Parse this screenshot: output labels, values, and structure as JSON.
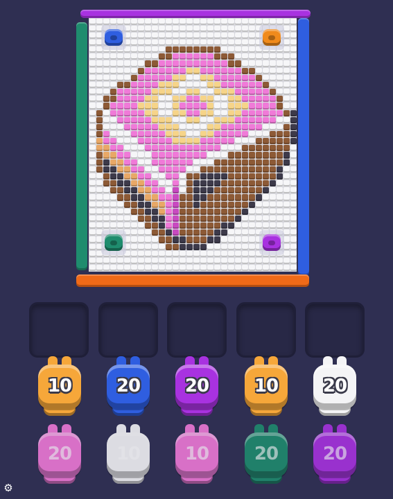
{
  "colors": {
    "background": "#2f2f52",
    "W": "#f6f6f8",
    "P": "#f07ad8",
    "M": "#c84ac0",
    "Y": "#f6d489",
    "T": "#e8a867",
    "B": "#8d5a36",
    "D": "#3d3a4a",
    "G": "#1f9a78",
    "rail_purple": "#a832e0",
    "rail_blue": "#2f5ee0",
    "rail_green": "#1f8c6e",
    "rail_orange": "#f06a18"
  },
  "pixel_art": [
    "WWWWWWWWWWWWWWWWWWWWWWWWWWWWWW",
    "WWWWWWWWWWWWWWWWWWWWWWWWWWWWWW",
    "WWWWWWWWWWWWWWWWWWWWWWWWWWWWWW",
    "WWWWWWWWWWWWWWWWWWWWWWWWWWWWWW",
    "WWWWWWWWWWWBBBBBBBBWWWWWWWWWWW",
    "WWWWWWWWWWBBPPPPPPBBBWWWWWWWWW",
    "WWWWWWWWBBPPPPPPPPPPBBWWWWWWWW",
    "WWWWWWWBPPPPPPYYPPPPPPBBWWWWWW",
    "WWWWWWBPPPPPYYWWYYPPPPPPBWWWWW",
    "WWWWBBPPPPYYYWWWWYYPPPPPPBWWWW",
    "WWWBPPPPPYYYWWYYWWYYYPPPPPBWWW",
    "WWBBPPPPYYWWYYPPYYWWYYPPPPPBWW",
    "WWBPPPPYYYWWYPPPPYWWYYYPPPPBWW",
    "WBWPPPPPYYWWYYPPYYWWYYPPPPPPBD",
    "WBWWPPPPPYYYWWYYWWYYYPPPPPPWWD",
    "WBWWWPPPPPYYYWWWWYYPPPPPPWWWBD",
    "WBPWWWPPPPPYYYWWYYPPPPPWWWBBBD",
    "WTPPWWWPPPPPYYYYPPPPPWWWBBBBBD",
    "WTTPPWWWPPPPPPPPPPPWWWBBBBBBBW",
    "WBTTPPWWWPPPPPPPPWWWBBBBBBBBDW",
    "WBDTTPPWWPPPPPPWWWBBBBBBBBBBDW",
    "WBDDTTPPWWPPPPWWBBBBBBBBBBBDWW",
    "WWBDDTTPPWWPPWBBDDDDBBBBBBBDWW",
    "WWBBDDTTPPWWPWBDDDDBBBBBBBDWWW",
    "WWWBBDDTTPPWMWBDDDBBBBBBBDWWWW",
    "WWWWBBDDTTPPMBBDDBBBBBBBDWWWWW",
    "WWWWWBBDDTTPMBBDBBBBBBBDWWWWWW",
    "WWWWWWBBDDTPMBBBBBBBBBDWWWWWWW",
    "WWWWWWWBBDDPMBBBBBBBBDWWWWWWWW",
    "WWWWWWWWBBDPMBBBBBBDDWWWWWWWWW",
    "WWWWWWWWWBBDMBBBBBDDWWWWWWWWWW",
    "WWWWWWWWWWBBDDBBBDDWWWWWWWWWWW",
    "WWWWWWWWWWWBBDDDDWWWWWWWWWWWWW",
    "WWWWWWWWWWWWWWWWWWWWWWWWWWWWWW",
    "WWWWWWWWWWWWWWWWWWWWWWWWWWWWWW",
    "WWWWWWWWWWWWWWWWWWWWWWWWWWWWWW"
  ],
  "corner_launchers": [
    {
      "name": "launcher-top-left",
      "color": "#2f5ee0"
    },
    {
      "name": "launcher-top-right",
      "color": "#f08a1c"
    },
    {
      "name": "launcher-bottom-left",
      "color": "#1f8c6e"
    },
    {
      "name": "launcher-bottom-right",
      "color": "#a832e0"
    }
  ],
  "empty_slots": [
    "slot-1",
    "slot-2",
    "slot-3",
    "slot-4",
    "slot-5"
  ],
  "queue": [
    [
      {
        "count": "10",
        "color": "#f6a73a",
        "faded": false
      },
      {
        "count": "20",
        "color": "#2f5ee0",
        "faded": false
      },
      {
        "count": "20",
        "color": "#a832e0",
        "faded": false
      },
      {
        "count": "10",
        "color": "#f6a73a",
        "faded": false
      },
      {
        "count": "20",
        "color": "#f4f4f6",
        "faded": false
      }
    ],
    [
      {
        "count": "20",
        "color": "#f07ad8",
        "faded": true
      },
      {
        "count": "10",
        "color": "#f4f4f6",
        "faded": true
      },
      {
        "count": "10",
        "color": "#f07ad8",
        "faded": true
      },
      {
        "count": "20",
        "color": "#1f8c6e",
        "faded": true
      },
      {
        "count": "20",
        "color": "#a832e0",
        "faded": true
      }
    ]
  ],
  "icons": {
    "settings": "gear-icon"
  }
}
